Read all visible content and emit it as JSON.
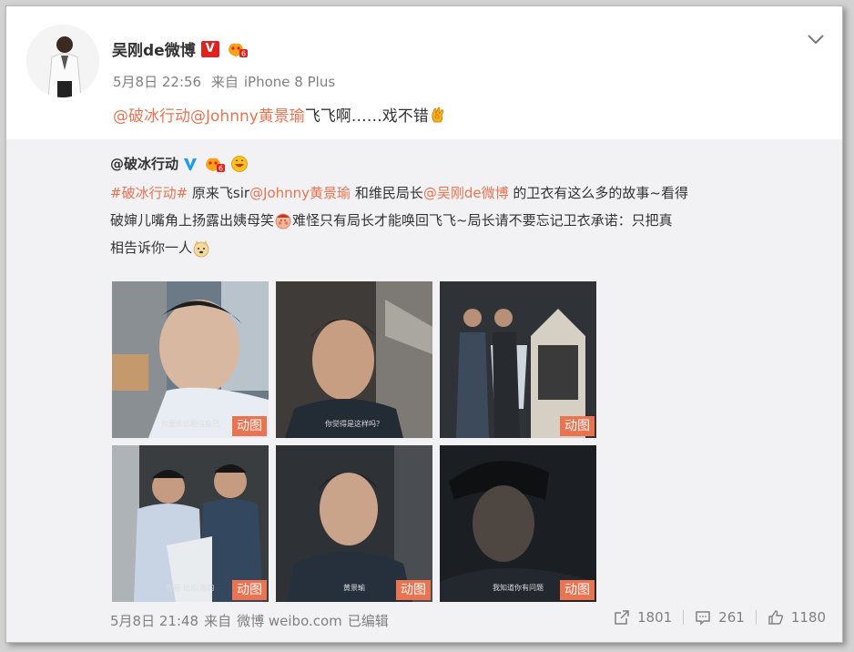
{
  "post": {
    "author": "吴刚de微博",
    "verified_badge": "V",
    "time": "5月8日 22:56",
    "source_prefix": "来自",
    "source": "iPhone 8 Plus",
    "text_mention": "@破冰行动@Johnny黄景瑜",
    "text_body": " 飞飞啊……戏不错"
  },
  "repost": {
    "author": "@破冰行动",
    "line1": {
      "tag": "#破冰行动#",
      "t1": " 原来飞sir",
      "m1": "@Johnny黄景瑜",
      "t2": " 和维民局长",
      "m2": "@吴刚de微博",
      "t3": " 的卫衣有这么多的故事~看得"
    },
    "line2": "破婶儿嘴角上扬露出姨母笑",
    "line2b": "难怪只有局长才能唤回飞飞~局长请不要忘记卫衣承诺：只把真",
    "line3": "相告诉你一人",
    "gif_label": "动图",
    "captions": [
      "你要永远相信自己",
      "你觉得是这样吗？",
      "",
      "你看 比如 你的",
      "黄景瑜",
      "我知道你有问题"
    ],
    "time": "5月8日 21:48",
    "source_prefix": "来自",
    "source": "微博 weibo.com",
    "edited": "已编辑",
    "counts": {
      "repost": "1801",
      "comment": "261",
      "like": "1180"
    }
  },
  "colors": {
    "mention": "#eb7350",
    "repost_bg": "#f2f2f5",
    "verified_red": "#e2211c",
    "verified_blue": "#1d9bf0"
  },
  "icons": [
    "chevron-down-icon",
    "verified-badge-icon",
    "member-badge-icon",
    "ok-hand-emoji",
    "blue-verified-icon",
    "grin-emoji",
    "repost-icon",
    "comment-icon",
    "like-icon"
  ]
}
